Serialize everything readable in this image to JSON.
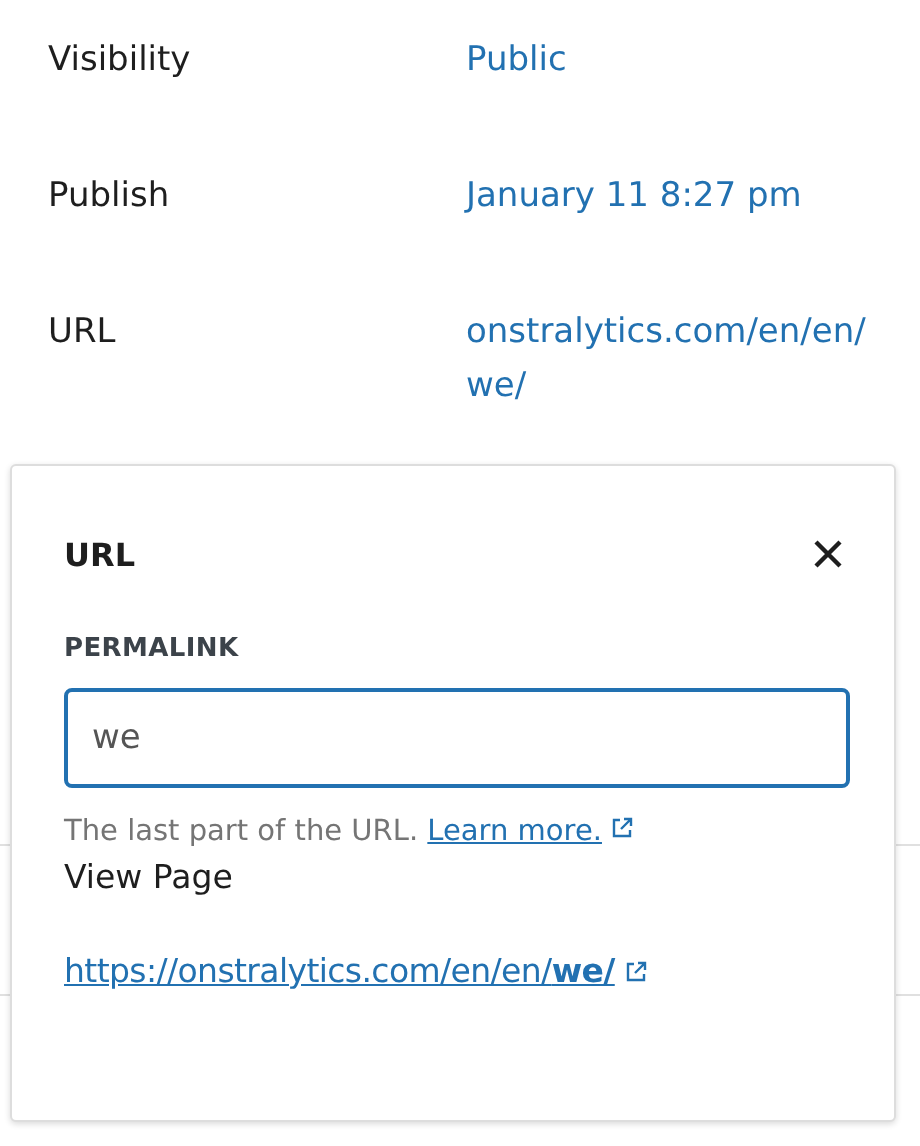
{
  "settings": [
    {
      "label": "Visibility",
      "value": "Public"
    },
    {
      "label": "Publish",
      "value": "January 11 8:27 pm"
    },
    {
      "label": "URL",
      "value": "onstralytics.com/en/en/we/"
    }
  ],
  "popover": {
    "title": "URL",
    "field": {
      "label": "PERMALINK",
      "value": "we"
    },
    "help": "The last part of the URL.",
    "help_link": "Learn more.",
    "view_label": "View Page",
    "view_link": "https://onstralytics.com/en/en/**we/**"
  }
}
